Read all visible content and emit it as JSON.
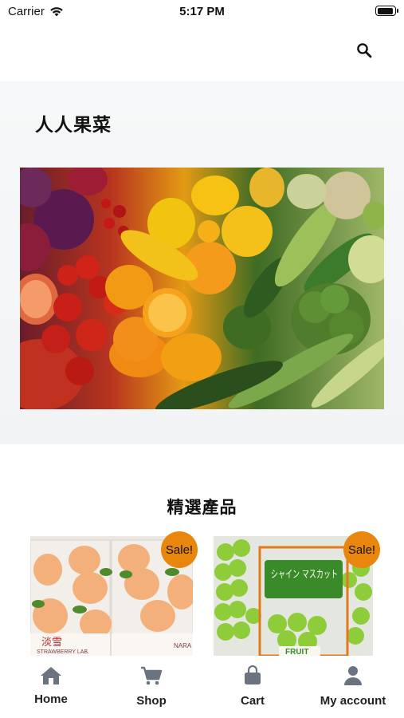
{
  "status_bar": {
    "carrier": "Carrier",
    "time": "5:17 PM"
  },
  "header": {
    "search_icon": "search-icon"
  },
  "hero": {
    "store_title": "人人果菜"
  },
  "featured": {
    "title": "精選產品",
    "products": [
      {
        "badge": "Sale!",
        "image_text": "淡雪",
        "image_subtext": "STRAWBERRY LAB.",
        "image_subtext2": "NARA"
      },
      {
        "badge": "Sale!",
        "image_text": "シャイン マスカット",
        "image_subtext": "FRUIT"
      }
    ]
  },
  "tab_bar": {
    "items": [
      {
        "label": "Home",
        "icon": "home-icon"
      },
      {
        "label": "Shop",
        "icon": "cart-icon"
      },
      {
        "label": "Cart",
        "icon": "bag-icon"
      },
      {
        "label": "My account",
        "icon": "user-icon"
      }
    ]
  },
  "colors": {
    "sale_badge": "#e8860e",
    "tab_icon": "#6b7280",
    "hero_bg": "#f4f5f7"
  }
}
